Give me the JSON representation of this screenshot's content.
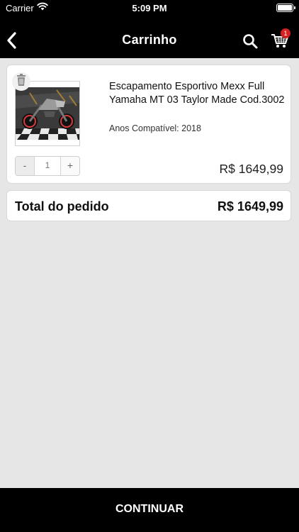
{
  "status_bar": {
    "carrier": "Carrier",
    "time": "5:09 PM"
  },
  "nav": {
    "title": "Carrinho",
    "cart_count": "1"
  },
  "cart": {
    "items": [
      {
        "name": "Escapamento Esportivo Mexx Full Yamaha MT 03 Taylor Made Cod.3002",
        "compat": "Anos Compatível: 2018",
        "quantity": "1",
        "minus_label": "-",
        "plus_label": "+",
        "price": "R$ 1649,99"
      }
    ],
    "total_label": "Total do pedido",
    "total_value": "R$ 1649,99"
  },
  "footer": {
    "continue_label": "CONTINUAR"
  },
  "colors": {
    "accent": "#000000",
    "badge": "#d32020",
    "background": "#e6e6e6"
  }
}
